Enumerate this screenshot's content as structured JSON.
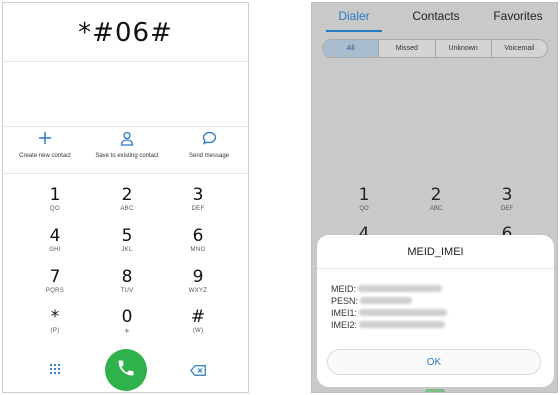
{
  "left": {
    "dial_input": "*#06#",
    "actions": [
      {
        "icon": "plus-icon",
        "label": "Create new contact"
      },
      {
        "icon": "person-icon",
        "label": "Save to existing contact"
      },
      {
        "icon": "message-icon",
        "label": "Send message"
      }
    ],
    "keys": [
      {
        "digit": "1",
        "letters": "QO"
      },
      {
        "digit": "2",
        "letters": "ABC"
      },
      {
        "digit": "3",
        "letters": "DEF"
      },
      {
        "digit": "4",
        "letters": "GHI"
      },
      {
        "digit": "5",
        "letters": "JKL"
      },
      {
        "digit": "6",
        "letters": "MNO"
      },
      {
        "digit": "7",
        "letters": "PQRS"
      },
      {
        "digit": "8",
        "letters": "TUV"
      },
      {
        "digit": "9",
        "letters": "WXYZ"
      },
      {
        "digit": "*",
        "letters": "(P)"
      },
      {
        "digit": "0",
        "letters": "+"
      },
      {
        "digit": "#",
        "letters": "(W)"
      }
    ],
    "bottom": {
      "keypad_icon": "dialpad-icon",
      "call_icon": "phone-icon",
      "delete_icon": "backspace-icon"
    },
    "colors": {
      "accent": "#2a79c4",
      "call_green": "#2fb24b"
    }
  },
  "right": {
    "tabs": [
      {
        "label": "Dialer",
        "active": true
      },
      {
        "label": "Contacts",
        "active": false
      },
      {
        "label": "Favorites",
        "active": false
      }
    ],
    "filters": [
      {
        "label": "All",
        "active": true
      },
      {
        "label": "Missed",
        "active": false
      },
      {
        "label": "Unknown",
        "active": false
      },
      {
        "label": "Voicemail",
        "active": false
      }
    ],
    "keys": [
      {
        "digit": "1",
        "letters": "QO"
      },
      {
        "digit": "2",
        "letters": "ABC"
      },
      {
        "digit": "3",
        "letters": "DEF"
      },
      {
        "digit": "4",
        "letters": ""
      },
      {
        "digit": "6",
        "letters": ""
      }
    ],
    "dialog": {
      "title": "MEID_IMEI",
      "rows": [
        {
          "key": "MEID:"
        },
        {
          "key": "PESN:"
        },
        {
          "key": "IMEI1:"
        },
        {
          "key": "IMEI2:"
        }
      ],
      "ok_label": "OK"
    }
  }
}
